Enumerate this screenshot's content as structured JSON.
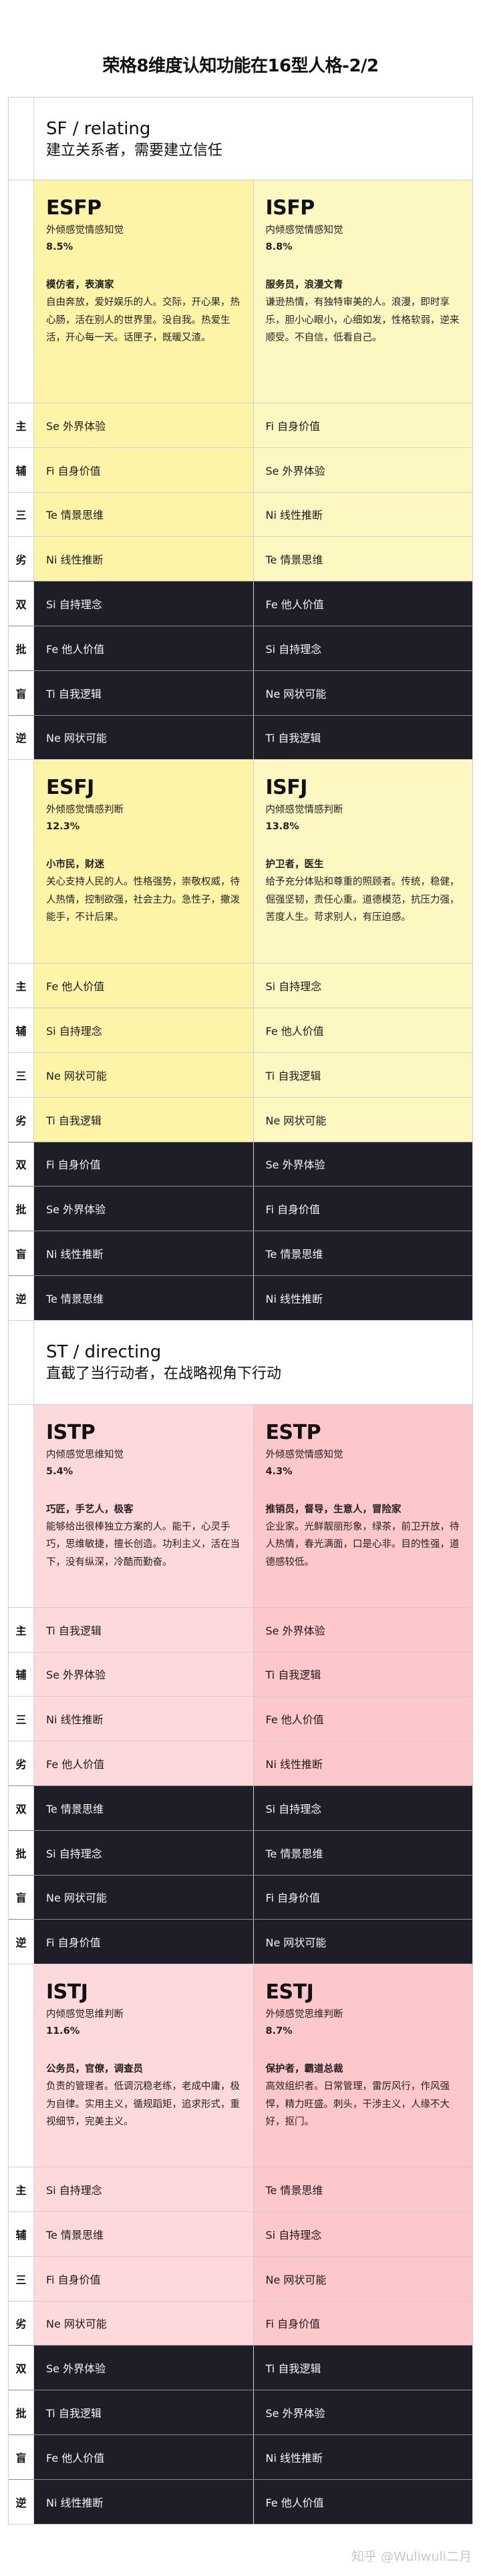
{
  "title": "荣格8维度认知功能在16型人格-2/2",
  "watermark": "知乎 @Wuliwuli二月",
  "colors": {
    "yellow_left": "#fdf4a8",
    "yellow_right": "#fdf8c2",
    "pink_left": "#fdd9dc",
    "pink_right": "#fcc8cc",
    "dark": "#1e1e28"
  },
  "row_labels": [
    "主",
    "辅",
    "三",
    "劣",
    "双",
    "批",
    "盲",
    "逆"
  ],
  "groups": [
    {
      "title": "SF / relating",
      "subtitle": "建立关系者，需要建立信任",
      "blocks": [
        {
          "types": [
            {
              "code": "ESFP",
              "name": "外倾感觉情感知觉",
              "percent": "8.5%",
              "nickname": "模仿者，表演家",
              "description": "自由奔放，爱好娱乐的人。交际，开心果，热心肠，活在别人的世界里。没自我。热爱生活，开心每一天。话匣子，既暖又渣。",
              "functions": [
                "Se 外界体验",
                "Fi 自身价值",
                "Te 情景思维",
                "Ni 线性推断",
                "Si 自持理念",
                "Fe 他人价值",
                "Ti 自我逻辑",
                "Ne 网状可能"
              ]
            },
            {
              "code": "ISFP",
              "name": "内倾感觉情感知觉",
              "percent": "8.8%",
              "nickname": "服务员，浪漫文青",
              "description": "谦逊热情，有独特审美的人。浪漫，即时享乐，胆小心眼小，心细如发，性格软弱，逆来顺受。不自信，低看自己。",
              "functions": [
                "Fi 自身价值",
                "Se 外界体验",
                "Ni 线性推断",
                "Te 情景思维",
                "Fe 他人价值",
                "Si 自持理念",
                "Ne 网状可能",
                "Ti 自我逻辑"
              ]
            }
          ]
        },
        {
          "types": [
            {
              "code": "ESFJ",
              "name": "外倾感觉情感判断",
              "percent": "12.3%",
              "nickname": "小市民，财迷",
              "description": "关心支持人民的人。性格强势，崇敬权威，待人热情，控制欲强，社会主力。急性子，撒泼能手，不计后果。",
              "functions": [
                "Fe 他人价值",
                "Si 自持理念",
                "Ne 网状可能",
                "Ti 自我逻辑",
                "Fi 自身价值",
                "Se 外界体验",
                "Ni 线性推断",
                "Te 情景思维"
              ]
            },
            {
              "code": "ISFJ",
              "name": "内倾感觉情感判断",
              "percent": "13.8%",
              "nickname": "护卫者，医生",
              "description": "给予充分体贴和尊重的照顾者。传统，稳健，倔强坚韧，责任心重。道德模范，抗压力强，苦度人生。苛求别人，有压迫感。",
              "functions": [
                "Si 自持理念",
                "Fe 他人价值",
                "Ti 自我逻辑",
                "Ne 网状可能",
                "Se 外界体验",
                "Fi 自身价值",
                "Te 情景思维",
                "Ni 线性推断"
              ]
            }
          ]
        }
      ]
    },
    {
      "title": "ST / directing",
      "subtitle": "直截了当行动者，在战略视角下行动",
      "blocks": [
        {
          "types": [
            {
              "code": "ISTP",
              "name": "内倾感觉思维知觉",
              "percent": "5.4%",
              "nickname": "巧匠，手艺人，极客",
              "description": "能够给出很棒独立方案的人。能干，心灵手巧，思维敏捷，擅长创造。功利主义，活在当下，没有纵深，冷酷而勤奋。",
              "functions": [
                "Ti 自我逻辑",
                "Se 外界体验",
                "Ni 线性推断",
                "Fe 他人价值",
                "Te 情景思维",
                "Si 自持理念",
                "Ne 网状可能",
                "Fi 自身价值"
              ]
            },
            {
              "code": "ESTP",
              "name": "外倾感觉情感知觉",
              "percent": "4.3%",
              "nickname": "推销员，督导，生意人，冒险家",
              "description": "企业家。光鲜靓丽形象，绿茶，前卫开放，待人热情，春光满面，口是心非。目的性强，道德感较低。",
              "functions": [
                "Se 外界体验",
                "Ti 自我逻辑",
                "Fe 他人价值",
                "Ni 线性推断",
                "Si 自持理念",
                "Te 情景思维",
                "Fi 自身价值",
                "Ne 网状可能"
              ]
            }
          ]
        },
        {
          "types": [
            {
              "code": "ISTJ",
              "name": "内倾感觉思维判断",
              "percent": "11.6%",
              "nickname": "公务员，官僚，调查员",
              "description": "负责的管理者。低调沉稳老练，老成中庸，极为自律。实用主义，循规蹈矩，追求形式，重视细节，完美主义。",
              "functions": [
                "Si 自持理念",
                "Te 情景思维",
                "Fi 自身价值",
                "Ne 网状可能",
                "Se 外界体验",
                "Ti 自我逻辑",
                "Fe 他人价值",
                "Ni 线性推断"
              ]
            },
            {
              "code": "ESTJ",
              "name": "外倾感觉思维判断",
              "percent": "8.7%",
              "nickname": "保护者，霸道总裁",
              "description": "高效组织者。日常管理，雷厉风行，作风强悍，精力旺盛。刺头，干涉主义，人缘不大好，抠门。",
              "functions": [
                "Te 情景思维",
                "Si 自持理念",
                "Ne 网状可能",
                "Fi 自身价值",
                "Ti 自我逻辑",
                "Se 外界体验",
                "Ni 线性推断",
                "Fe 他人价值"
              ]
            }
          ]
        }
      ]
    }
  ]
}
